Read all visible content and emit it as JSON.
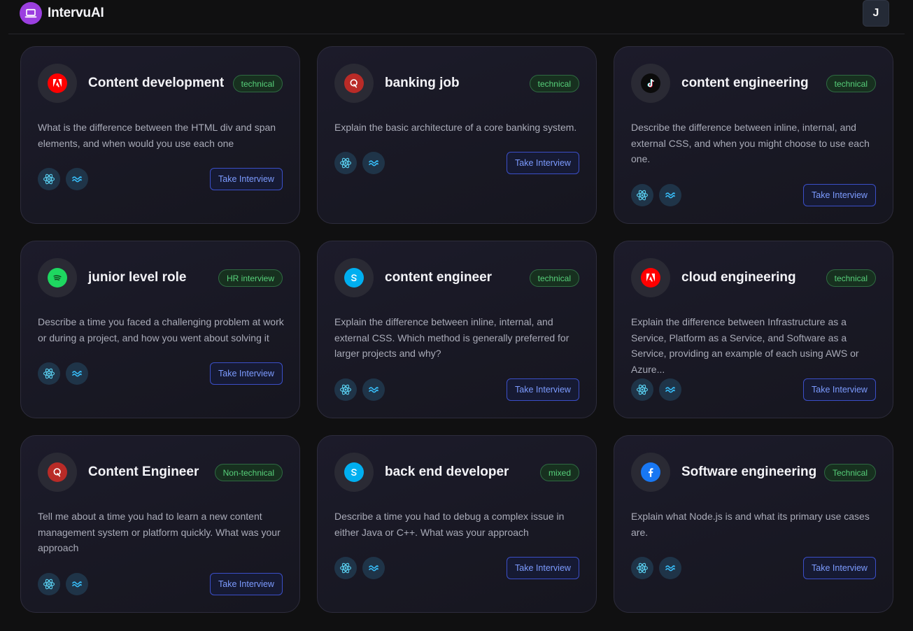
{
  "app": {
    "name": "IntervuAI",
    "user_initial": "J"
  },
  "cards": [
    {
      "title": "Content development",
      "badge": "technical",
      "company_icon": "adobe-logo-icon",
      "question": "What is the difference between the HTML div and span elements, and when would you use each one",
      "tech_icons": [
        "react-icon",
        "tailwind-icon"
      ],
      "button": "Take Interview"
    },
    {
      "title": "banking job",
      "badge": "technical",
      "company_icon": "quora-logo-icon",
      "question": "Explain the basic architecture of a core banking system.",
      "tech_icons": [
        "react-icon",
        "tailwind-icon"
      ],
      "button": "Take Interview"
    },
    {
      "title": "content engineering",
      "badge": "technical",
      "company_icon": "tiktok-logo-icon",
      "question": "Describe the difference between inline, internal, and external CSS, and when you might choose to use each one.",
      "tech_icons": [
        "react-icon",
        "tailwind-icon"
      ],
      "button": "Take Interview"
    },
    {
      "title": "junior level role",
      "badge": "HR interview",
      "company_icon": "spotify-logo-icon",
      "question": "Describe a time you faced a challenging problem at work or during a project, and how you went about solving it",
      "tech_icons": [
        "react-icon",
        "tailwind-icon"
      ],
      "button": "Take Interview"
    },
    {
      "title": "content engineer",
      "badge": "technical",
      "company_icon": "skype-logo-icon",
      "question": "Explain the difference between inline, internal, and external CSS. Which method is generally preferred for larger projects and why?",
      "tech_icons": [
        "react-icon",
        "tailwind-icon"
      ],
      "button": "Take Interview"
    },
    {
      "title": "cloud engineering",
      "badge": "technical",
      "company_icon": "adobe-logo-icon",
      "question": "Explain the difference between Infrastructure as a Service, Platform as a Service, and Software as a Service, providing an example of each using AWS or Azure...",
      "tech_icons": [
        "react-icon",
        "tailwind-icon"
      ],
      "button": "Take Interview"
    },
    {
      "title": "Content Engineer",
      "badge": "Non-technical",
      "company_icon": "quora-logo-icon",
      "question": "Tell me about a time you had to learn a new content management system or platform quickly. What was your approach",
      "tech_icons": [
        "react-icon",
        "tailwind-icon"
      ],
      "button": "Take Interview"
    },
    {
      "title": "back end developer",
      "badge": "mixed",
      "company_icon": "skype-logo-icon",
      "question": "Describe a time you had to debug a complex issue in either Java or C++. What was your approach",
      "tech_icons": [
        "react-icon",
        "tailwind-icon"
      ],
      "button": "Take Interview"
    },
    {
      "title": "Software engineering",
      "badge": "Technical",
      "company_icon": "facebook-logo-icon",
      "question": "Explain what Node.js is and what its primary use cases are.",
      "tech_icons": [
        "react-icon",
        "tailwind-icon"
      ],
      "button": "Take Interview"
    }
  ],
  "colors": {
    "background": "#101011",
    "card": "#1a1a26",
    "accent_purple": "#9b3fe0",
    "badge_green": "#57d07a",
    "button_blue": "#7c9bff"
  }
}
